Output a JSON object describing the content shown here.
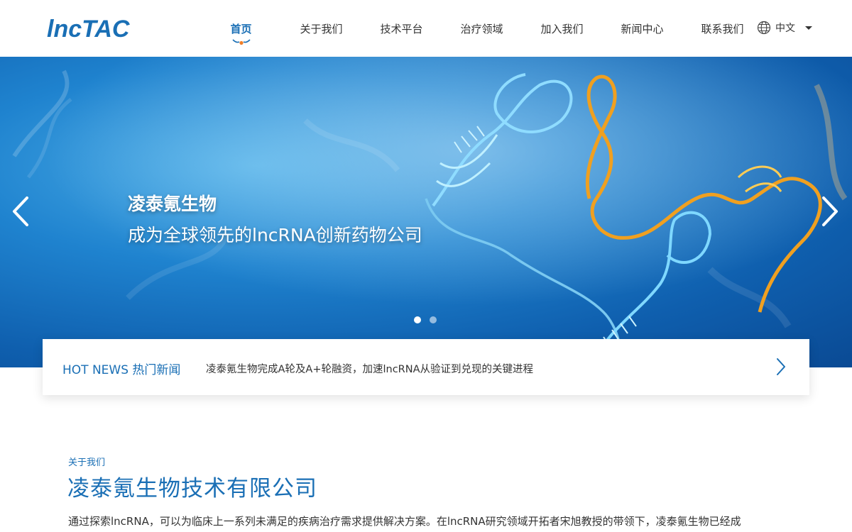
{
  "brand": {
    "logo_text": "lncTAC",
    "primary_color": "#1a6fb5",
    "accent_color": "#f0802a"
  },
  "nav": {
    "items": [
      {
        "label": "首页",
        "active": true
      },
      {
        "label": "关于我们"
      },
      {
        "label": "技术平台"
      },
      {
        "label": "治疗领域"
      },
      {
        "label": "加入我们"
      },
      {
        "label": "新闻中心"
      },
      {
        "label": "联系我们"
      }
    ],
    "language": {
      "label": "中文",
      "icon": "globe-icon"
    }
  },
  "banner": {
    "title": "凌泰氪生物",
    "subtitle": "成为全球领先的lncRNA创新药物公司",
    "slide_count": 2,
    "active_slide": 1,
    "prev_icon": "chevron-left-icon",
    "next_icon": "chevron-right-icon"
  },
  "hot_news": {
    "label": "HOT NEWS 热门新闻",
    "headline": "凌泰氪生物完成A轮及A+轮融资，加速lncRNA从验证到兑现的关键进程",
    "icon": "chevron-right-icon"
  },
  "about": {
    "kicker": "关于我们",
    "title": "凌泰氪生物技术有限公司",
    "body": "通过探索lncRNA，可以为临床上一系列未满足的疾病治疗需求提供解决方案。在lncRNA研究领域开拓者宋旭教授的带领下，凌泰氪生物已经成"
  }
}
